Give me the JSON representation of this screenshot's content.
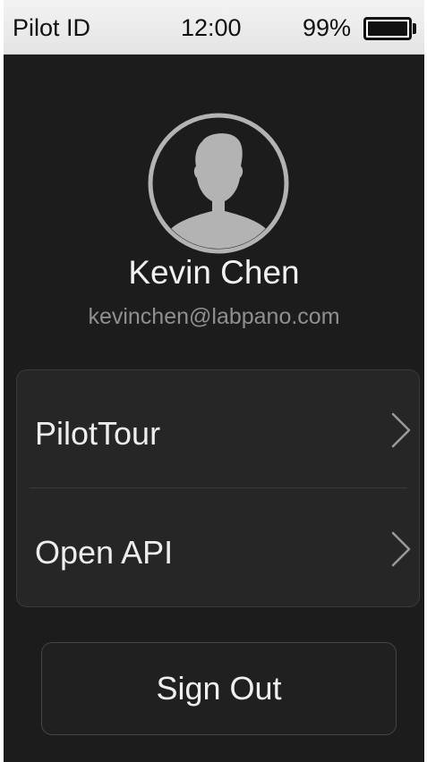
{
  "status_bar": {
    "app_name": "Pilot ID",
    "time": "12:00",
    "battery_percent_text": "99%",
    "battery_level": 0.99
  },
  "profile": {
    "avatar_icon": "user-silhouette-icon",
    "name": "Kevin Chen",
    "email": "kevinchen@labpano.com"
  },
  "menu": {
    "items": [
      {
        "label": "PilotTour",
        "icon": "chevron-right-icon"
      },
      {
        "label": "Open API",
        "icon": "chevron-right-icon"
      }
    ]
  },
  "actions": {
    "sign_out_label": "Sign Out"
  },
  "colors": {
    "background": "#1c1c1c",
    "card": "#262626",
    "status_bar": "#ececec",
    "text_primary": "#f1f1f1",
    "text_secondary": "#8f8f8f",
    "avatar": "#b3b3b3"
  }
}
